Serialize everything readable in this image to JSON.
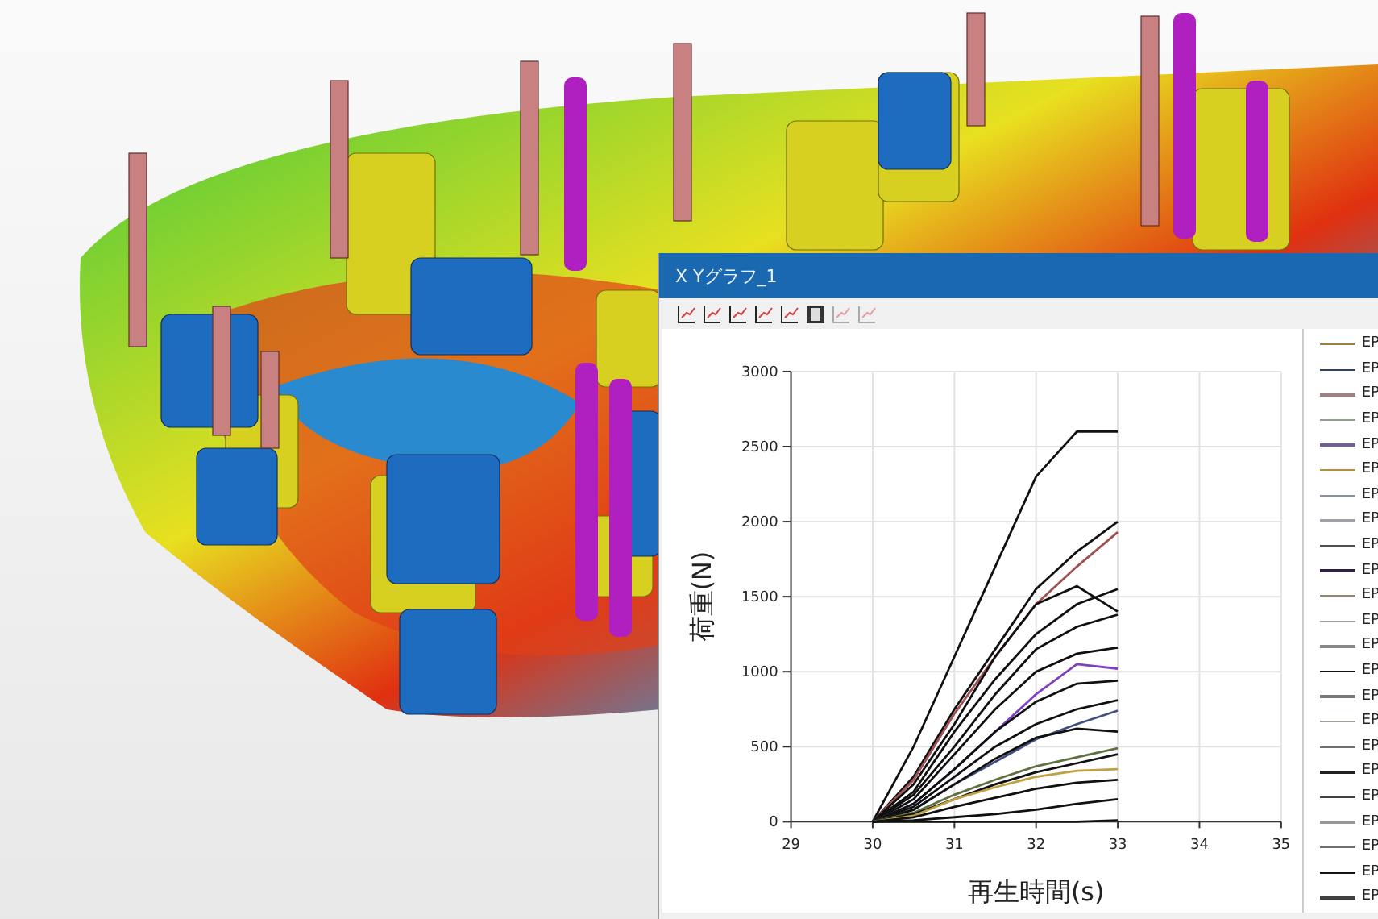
{
  "graph_window": {
    "title": "X Yグラフ_1",
    "toolbar": [
      {
        "kind": "chart"
      },
      {
        "kind": "chart"
      },
      {
        "kind": "chart"
      },
      {
        "kind": "chart"
      },
      {
        "kind": "chart"
      },
      {
        "kind": "film"
      },
      {
        "kind": "chart-faded"
      },
      {
        "kind": "chart-faded"
      }
    ],
    "chart_data": {
      "type": "line",
      "xlabel": "再生時間(s)",
      "ylabel": "荷重(N)",
      "grid": true,
      "xlim": [
        29,
        35
      ],
      "ylim": [
        0,
        3000
      ],
      "xticks": [
        29,
        30,
        31,
        32,
        33,
        34,
        35
      ],
      "yticks": [
        0,
        500,
        1000,
        1500,
        2000,
        2500,
        3000
      ],
      "x": [
        30,
        30.5,
        31,
        31.5,
        32,
        32.5,
        33
      ],
      "series": [
        {
          "color": "#101010",
          "values": [
            0,
            500,
            1100,
            1700,
            2300,
            2600,
            2600
          ]
        },
        {
          "color": "#101010",
          "values": [
            0,
            300,
            750,
            1150,
            1550,
            1800,
            2000
          ]
        },
        {
          "color": "#a05050",
          "values": [
            0,
            280,
            720,
            1100,
            1450,
            1700,
            1930
          ]
        },
        {
          "color": "#101010",
          "values": [
            0,
            250,
            650,
            1100,
            1450,
            1570,
            1400
          ]
        },
        {
          "color": "#101010",
          "values": [
            0,
            200,
            600,
            950,
            1250,
            1450,
            1550
          ]
        },
        {
          "color": "#101010",
          "values": [
            0,
            180,
            500,
            850,
            1150,
            1300,
            1380
          ]
        },
        {
          "color": "#101010",
          "values": [
            0,
            150,
            450,
            750,
            1000,
            1120,
            1160
          ]
        },
        {
          "color": "#8040c0",
          "values": [
            0,
            120,
            350,
            600,
            850,
            1050,
            1020
          ]
        },
        {
          "color": "#101010",
          "values": [
            0,
            120,
            350,
            600,
            800,
            920,
            940
          ]
        },
        {
          "color": "#101010",
          "values": [
            0,
            100,
            300,
            500,
            650,
            750,
            810
          ]
        },
        {
          "color": "#405080",
          "values": [
            0,
            80,
            250,
            400,
            550,
            650,
            740
          ]
        },
        {
          "color": "#101010",
          "values": [
            0,
            80,
            250,
            420,
            560,
            620,
            600
          ]
        },
        {
          "color": "#607040",
          "values": [
            0,
            60,
            180,
            280,
            370,
            430,
            490
          ]
        },
        {
          "color": "#101010",
          "values": [
            0,
            50,
            150,
            250,
            330,
            390,
            450
          ]
        },
        {
          "color": "#c0a040",
          "values": [
            0,
            40,
            150,
            230,
            300,
            340,
            350
          ]
        },
        {
          "color": "#101010",
          "values": [
            0,
            30,
            100,
            160,
            220,
            260,
            280
          ]
        },
        {
          "color": "#101010",
          "values": [
            0,
            10,
            30,
            50,
            80,
            120,
            150
          ]
        },
        {
          "color": "#101010",
          "values": [
            0,
            0,
            0,
            0,
            0,
            0,
            10
          ]
        }
      ]
    },
    "legend": [
      {
        "label": "EP",
        "color": "#a08040"
      },
      {
        "label": "EP",
        "color": "#304060"
      },
      {
        "label": "EP",
        "color": "#a08080"
      },
      {
        "label": "EP",
        "color": "#90a090"
      },
      {
        "label": "EP",
        "color": "#706090"
      },
      {
        "label": "EP",
        "color": "#b09040"
      },
      {
        "label": "EP",
        "color": "#8890a0"
      },
      {
        "label": "EP",
        "color": "#a0a0a8"
      },
      {
        "label": "EP",
        "color": "#505050"
      },
      {
        "label": "EP",
        "color": "#302040"
      },
      {
        "label": "EP",
        "color": "#908870"
      },
      {
        "label": "EP",
        "color": "#a0a4a8"
      },
      {
        "label": "EP",
        "color": "#888888"
      },
      {
        "label": "EP",
        "color": "#101010"
      },
      {
        "label": "EP",
        "color": "#7a7a7a"
      },
      {
        "label": "EP",
        "color": "#a0a098"
      },
      {
        "label": "EP",
        "color": "#707070"
      },
      {
        "label": "EP",
        "color": "#202020"
      },
      {
        "label": "EP",
        "color": "#404040"
      },
      {
        "label": "EP",
        "color": "#989898"
      },
      {
        "label": "EP",
        "color": "#707070"
      },
      {
        "label": "EP",
        "color": "#151515"
      },
      {
        "label": "EP",
        "color": "#404040"
      }
    ]
  }
}
